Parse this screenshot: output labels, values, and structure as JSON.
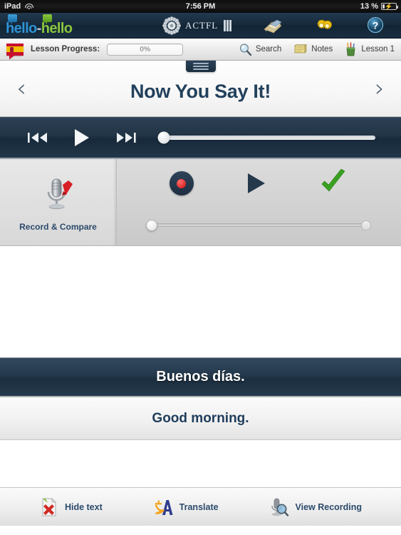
{
  "status_bar": {
    "carrier": "iPad",
    "wifi_icon": "wifi-icon",
    "time": "7:56 PM",
    "battery_percent": "13 %",
    "battery_icon": "battery-charging-icon"
  },
  "app_header": {
    "logo": {
      "part1": "hello",
      "dash": "-",
      "part2": "hello",
      "icon": "hello-hello-logo"
    },
    "certification": {
      "label": "ACTFL",
      "mark_icon": "actfl-starburst-icon",
      "bars_icon": "actfl-bars-icon"
    },
    "buttons": [
      {
        "name": "book-icon",
        "label": ""
      },
      {
        "name": "gears-icon",
        "label": ""
      },
      {
        "name": "help-question-icon",
        "label": ""
      }
    ]
  },
  "toolbar": {
    "flag_icon": "spanish-flag-icon",
    "progress_label": "Lesson Progress:",
    "progress_value": "0%",
    "progress_percent": 0,
    "items": [
      {
        "icon": "magnifier-icon",
        "label": "Search"
      },
      {
        "icon": "notepad-icon",
        "label": "Notes"
      },
      {
        "icon": "pencil-cup-icon",
        "label": "Lesson 1"
      }
    ]
  },
  "title_bar": {
    "handle_icon": "drawer-handle-icon",
    "prev_icon": "chevron-left-icon",
    "prev_label": "‹",
    "title": "Now You Say It!",
    "next_icon": "chevron-right-icon",
    "next_label": "›"
  },
  "player": {
    "prev_icon": "skip-previous-icon",
    "play_icon": "play-icon",
    "next_icon": "skip-next-icon",
    "progress_percent": 0
  },
  "record_compare": {
    "panel_label": "Record & Compare",
    "mic_icon": "microphone-check-icon",
    "record_icon": "record-icon",
    "play_icon": "play-icon",
    "check_icon": "green-check-icon",
    "slider_percent": 0
  },
  "phrase": {
    "target_text": "Buenos días.",
    "native_text": "Good morning."
  },
  "bottom_bar": {
    "items": [
      {
        "icon": "hide-text-icon",
        "label": "Hide text"
      },
      {
        "icon": "translate-icon",
        "label": "Translate"
      },
      {
        "icon": "view-recording-icon",
        "label": "View Recording"
      }
    ]
  },
  "colors": {
    "navy": "#24394c",
    "navy_dark": "#16293a",
    "title_blue": "#23415c",
    "logo_blue": "#2f93d6",
    "logo_green": "#8cc63f",
    "record_red": "#cc1111",
    "check_green": "#3aa021",
    "flag_red": "#c8102e",
    "flag_yellow": "#f1bf00"
  }
}
